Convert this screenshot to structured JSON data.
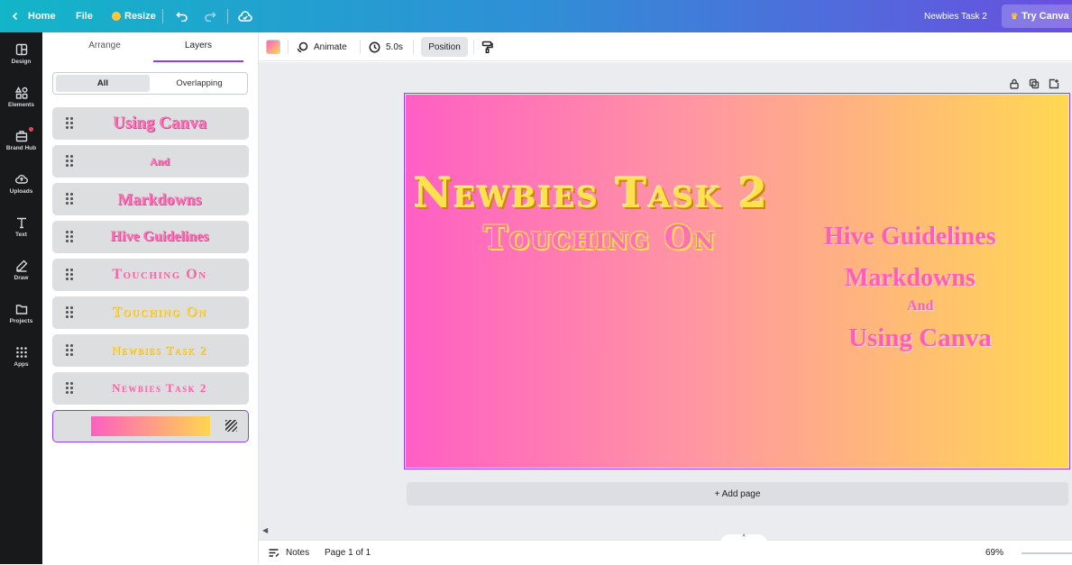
{
  "topbar": {
    "home_label": "Home",
    "file_label": "File",
    "resize_label": "Resize",
    "design_title": "Newbies Task 2",
    "try_label": "Try Canva Pro"
  },
  "rail": {
    "items": [
      {
        "label": "Design",
        "icon": "layout-icon"
      },
      {
        "label": "Elements",
        "icon": "shapes-icon"
      },
      {
        "label": "Brand Hub",
        "icon": "briefcase-icon"
      },
      {
        "label": "Uploads",
        "icon": "cloud-upload-icon"
      },
      {
        "label": "Text",
        "icon": "text-icon"
      },
      {
        "label": "Draw",
        "icon": "pen-icon"
      },
      {
        "label": "Projects",
        "icon": "folder-icon"
      },
      {
        "label": "Apps",
        "icon": "grid-icon"
      }
    ]
  },
  "panel": {
    "tabs": {
      "arrange": "Arrange",
      "layers": "Layers"
    },
    "filter": {
      "all": "All",
      "overlapping": "Overlapping"
    },
    "layers": [
      {
        "text": "Using Canva"
      },
      {
        "text": "And"
      },
      {
        "text": "Markdowns"
      },
      {
        "text": "Hive Guidelines"
      },
      {
        "text": "Touching On"
      },
      {
        "text": "Touching On"
      },
      {
        "text": "Newbies Task 2"
      },
      {
        "text": "Newbies Task 2"
      }
    ]
  },
  "toolbar": {
    "animate_label": "Animate",
    "duration_label": "5.0s",
    "position_label": "Position"
  },
  "canvas": {
    "title": "Newbies Task 2",
    "subtitle": "Touching On",
    "items": [
      "Hive Guidelines",
      "Markdowns",
      "And",
      "Using Canva"
    ],
    "add_page_label": "+ Add page"
  },
  "bottombar": {
    "notes_label": "Notes",
    "page_label": "Page 1 of 1",
    "zoom_label": "69%"
  },
  "colors": {
    "accent": "#8b3dff",
    "gradient_start": "#ff5fc4",
    "gradient_end": "#ffd852"
  }
}
